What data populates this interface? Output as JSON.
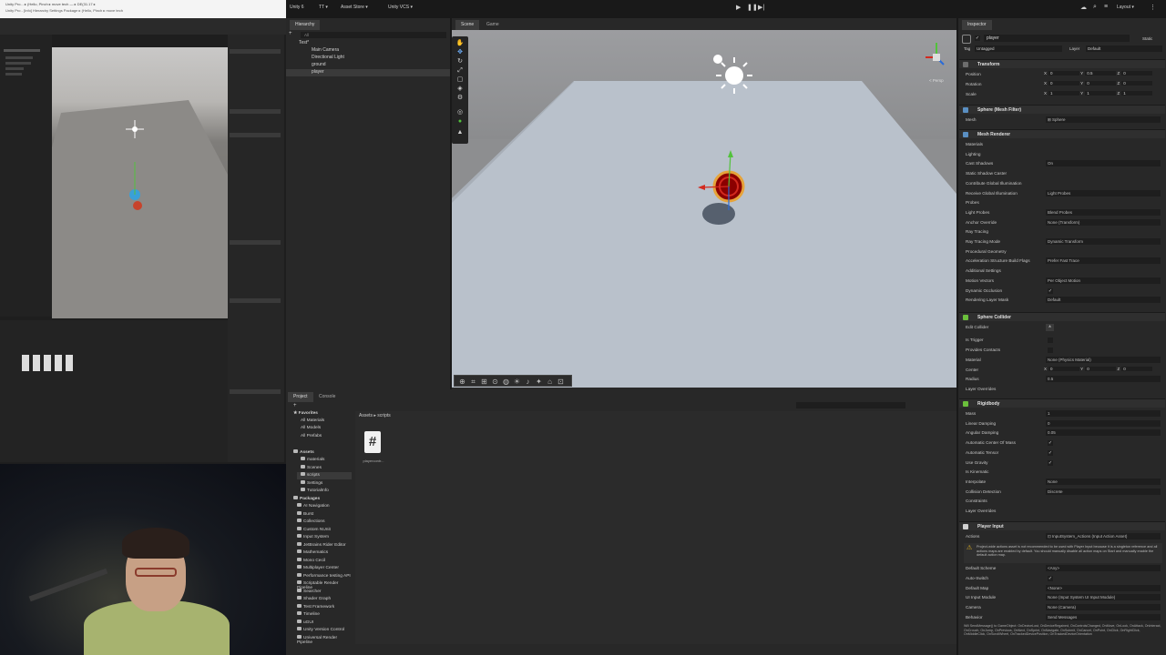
{
  "reference_video": {
    "titlebar_line1": "Unity Pro... ▸ (Hello, Pinch ▸ move tech — ▸ DE(31.17 ▸",
    "titlebar_line2": "Unity Pro - [Info] Hierarchy Settings Package ▸ (Hello, Pinch ▸ move tech"
  },
  "toolbar": {
    "account": "Unity 6",
    "tt": "TT ▾",
    "asset_store": "Asset Store ▾",
    "vcs": "Unity VCS ▾",
    "layout": "Layout ▾"
  },
  "hierarchy": {
    "tab": "Hierarchy",
    "search_placeholder": "All",
    "scene": "Test*",
    "items": [
      "Main Camera",
      "Directional Light",
      "ground",
      "player"
    ]
  },
  "scene_tabs": {
    "scene": "Scene",
    "game": "Game"
  },
  "gizmo_label": "< Persp",
  "project": {
    "tab_project": "Project",
    "tab_console": "Console",
    "breadcrumb": "Assets ▸ scripts",
    "favorites": [
      "Favorites",
      "All Materials",
      "All Models",
      "All Prefabs"
    ],
    "assets": [
      "Assets",
      "materials",
      "Scenes",
      "scripts",
      "Settings",
      "TutorialInfo"
    ],
    "packages": [
      "Packages",
      "AI Navigation",
      "Burst",
      "Collections",
      "Custom NUnit",
      "Input System",
      "JetBrains Rider Editor",
      "Mathematics",
      "Mono Cecil",
      "Multiplayer Center",
      "Performance testing API",
      "Scriptable Render Pipeline",
      "Searcher",
      "Shader Graph",
      "Test Framework",
      "Timeline",
      "uGUI",
      "Unity Version Control",
      "Universal Render Pipeline"
    ],
    "file_label": "playercontr..."
  },
  "inspector": {
    "tab": "Inspector",
    "object_name": "player",
    "static_label": "Static",
    "tag_label": "Tag",
    "tag_value": "Untagged",
    "layer_label": "Layer",
    "layer_value": "Default",
    "transform": {
      "title": "Transform",
      "position": [
        "0",
        "0.5",
        "0"
      ],
      "rotation": [
        "0",
        "0",
        "0"
      ],
      "scale": [
        "1",
        "1",
        "1"
      ],
      "labels": [
        "Position",
        "Rotation",
        "Scale"
      ]
    },
    "mesh_filter": {
      "title": "Sphere (Mesh Filter)",
      "mesh_label": "Mesh",
      "mesh_value": "⊞ Sphere"
    },
    "mesh_renderer": {
      "title": "Mesh Renderer",
      "rows": [
        [
          "Materials",
          ""
        ],
        [
          "Lighting",
          ""
        ],
        [
          "Cast Shadows",
          "On"
        ],
        [
          "Static Shadow Caster",
          ""
        ],
        [
          "Contribute Global Illumination",
          ""
        ],
        [
          "Receive Global Illumination",
          "Light Probes"
        ],
        [
          "Probes",
          ""
        ],
        [
          "Light Probes",
          "Blend Probes"
        ],
        [
          "Anchor Override",
          "None (Transform)"
        ],
        [
          "Ray Tracing",
          ""
        ],
        [
          "Ray Tracing Mode",
          "Dynamic Transform"
        ],
        [
          "Procedural Geometry",
          ""
        ],
        [
          "Acceleration Structure Build Flags",
          "Prefer Fast Trace"
        ],
        [
          "Additional Settings",
          ""
        ],
        [
          "Motion Vectors",
          "Per Object Motion"
        ],
        [
          "Dynamic Occlusion",
          "✓"
        ],
        [
          "Rendering Layer Mask",
          "Default"
        ]
      ]
    },
    "sphere_collider": {
      "title": "Sphere Collider",
      "rows": [
        [
          "Edit Collider",
          ""
        ],
        [
          "Is Trigger",
          ""
        ],
        [
          "Provides Contacts",
          ""
        ],
        [
          "Material",
          "None (Physics Material)"
        ],
        [
          "Radius",
          "0.5"
        ],
        [
          "Layer Overrides",
          ""
        ]
      ],
      "center_label": "Center",
      "center": [
        "0",
        "0",
        "0"
      ]
    },
    "rigidbody": {
      "title": "Rigidbody",
      "rows": [
        [
          "Mass",
          "1"
        ],
        [
          "Linear Damping",
          "0"
        ],
        [
          "Angular Damping",
          "0.05"
        ],
        [
          "Automatic Center Of Mass",
          "✓"
        ],
        [
          "Automatic Tensor",
          "✓"
        ],
        [
          "Use Gravity",
          "✓"
        ],
        [
          "Is Kinematic",
          ""
        ],
        [
          "Interpolate",
          "None"
        ],
        [
          "Collision Detection",
          "Discrete"
        ],
        [
          "Constraints",
          ""
        ],
        [
          "Layer Overrides",
          ""
        ]
      ]
    },
    "player_input": {
      "title": "Player Input",
      "actions_label": "Actions",
      "actions_value": "⊡ InputSystem_Actions (Input Action Asset)",
      "warning": "Project-wide actions asset is not recommended to be used with Player Input because it is a singleton reference and all actions maps are enabled by default. You should manually disable all action maps on Start and manually enable the default action map.",
      "rows": [
        [
          "Default Scheme",
          "<Any>"
        ],
        [
          "Auto-Switch",
          "✓"
        ],
        [
          "Default Map",
          "<None>"
        ],
        [
          "UI Input Module",
          "None (Input System UI Input Module)"
        ],
        [
          "Camera",
          "None (Camera)"
        ],
        [
          "Behavior",
          "Send Messages"
        ]
      ],
      "footer": "Will SendMessage() to GameObject: OnDeviceLost, OnDeviceRegained, OnControlsChanged, OnMove, OnLook, OnAttack, OnInteract, OnCrouch, OnJump, OnPrevious, OnNext, OnSprint, OnNavigate, OnSubmit, OnCancel, OnPoint, OnClick, OnRightClick, OnMiddleClick, OnScrollWheel, OnTrackedDevicePosition, OnTrackedDeviceOrientation"
    }
  },
  "colors": {
    "accent": "#3d6ea8",
    "selection": "#2c5d87",
    "gizmo_red": "#d32a1f",
    "gizmo_green": "#52c23c",
    "gizmo_blue": "#2a6bd8"
  }
}
